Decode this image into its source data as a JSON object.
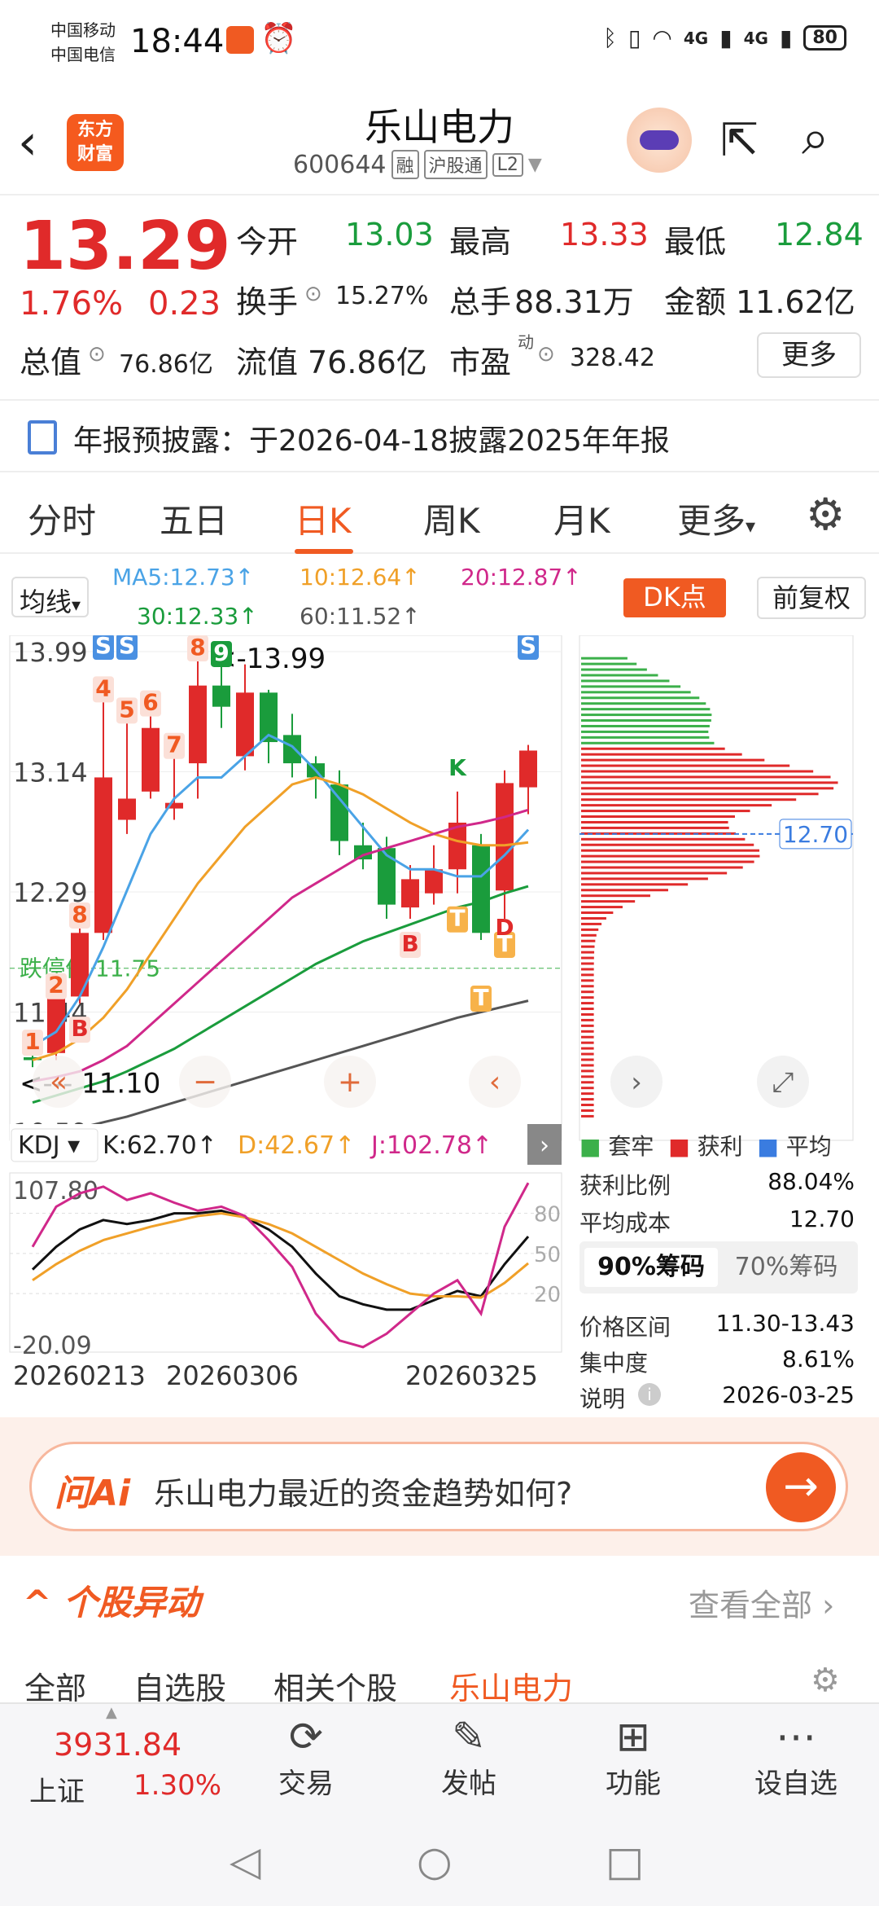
{
  "status_bar": {
    "carrier1": "中国移动",
    "carrier2": "中国电信",
    "time": "18:44",
    "signal1": "4G",
    "signal2": "4G",
    "battery": "80"
  },
  "header": {
    "logo_line1": "东方",
    "logo_line2": "财富",
    "stock_name": "乐山电力",
    "stock_code": "600644",
    "tags": [
      "融",
      "沪股通",
      "L2"
    ]
  },
  "quote": {
    "price": "13.29",
    "change_pct": "1.76%",
    "change": "0.23",
    "open_label": "今开",
    "open": "13.03",
    "high_label": "最高",
    "high": "13.33",
    "low_label": "最低",
    "low": "12.84",
    "turnover_label": "换手",
    "turnover": "15.27%",
    "volume_label": "总手",
    "volume": "88.31万",
    "amount_label": "金额",
    "amount": "11.62亿",
    "mcap_label": "总值",
    "mcap": "76.86亿",
    "float_label": "流值",
    "float_mcap": "76.86亿",
    "pe_label": "市盈",
    "pe_sup": "动",
    "pe": "328.42",
    "more": "更多"
  },
  "notice": {
    "text": "年报预披露：于2026-04-18披露2025年年报"
  },
  "tabs": [
    {
      "label": "分时"
    },
    {
      "label": "五日"
    },
    {
      "label": "日K"
    },
    {
      "label": "周K"
    },
    {
      "label": "月K"
    },
    {
      "label": "更多"
    }
  ],
  "ma_legend": {
    "selector": "均线",
    "ma5": "MA5:12.73↑",
    "ma10": "10:12.64↑",
    "ma20": "20:12.87↑",
    "ma30": "30:12.33↑",
    "ma60": "60:11.52↑",
    "dk_button": "DK点",
    "adjust_button": "前复权"
  },
  "colors": {
    "up": "#e02a2a",
    "down": "#1a9c3c",
    "accent": "#f05a22",
    "ma5": "#4aa3e6",
    "ma10": "#f0a028",
    "ma20": "#d0288a",
    "ma30": "#1a9c3c",
    "ma60": "#555555"
  },
  "kline": {
    "y_top": "13.99",
    "y_mid1": "13.14",
    "y_mid2": "12.29",
    "y_mid3": "11.44",
    "y_bottom": "10.59",
    "high_marker": "13.99",
    "low_marker": "11.10",
    "limit_down_label": "跌停价",
    "limit_down": "11.75",
    "candles": [
      {
        "o": 11.12,
        "c": 11.1,
        "h": 11.2,
        "l": 11.05
      },
      {
        "o": 11.15,
        "c": 11.55,
        "h": 11.6,
        "l": 11.1
      },
      {
        "o": 11.55,
        "c": 12.0,
        "h": 12.1,
        "l": 11.5
      },
      {
        "o": 12.0,
        "c": 13.1,
        "h": 13.7,
        "l": 11.95
      },
      {
        "o": 12.8,
        "c": 12.95,
        "h": 13.55,
        "l": 12.7
      },
      {
        "o": 13.0,
        "c": 13.45,
        "h": 13.6,
        "l": 12.95
      },
      {
        "o": 12.88,
        "c": 12.92,
        "h": 13.3,
        "l": 12.8
      },
      {
        "o": 13.2,
        "c": 13.75,
        "h": 13.99,
        "l": 12.95
      },
      {
        "o": 13.75,
        "c": 13.6,
        "h": 13.95,
        "l": 13.45
      },
      {
        "o": 13.25,
        "c": 13.7,
        "h": 13.9,
        "l": 13.15
      },
      {
        "o": 13.7,
        "c": 13.35,
        "h": 13.72,
        "l": 13.2
      },
      {
        "o": 13.4,
        "c": 13.2,
        "h": 13.55,
        "l": 13.1
      },
      {
        "o": 13.2,
        "c": 13.1,
        "h": 13.25,
        "l": 12.95
      },
      {
        "o": 13.05,
        "c": 12.65,
        "h": 13.15,
        "l": 12.55
      },
      {
        "o": 12.62,
        "c": 12.52,
        "h": 12.78,
        "l": 12.45
      },
      {
        "o": 12.6,
        "c": 12.2,
        "h": 12.68,
        "l": 12.1
      },
      {
        "o": 12.18,
        "c": 12.38,
        "h": 12.48,
        "l": 12.1
      },
      {
        "o": 12.28,
        "c": 12.45,
        "h": 12.62,
        "l": 12.2
      },
      {
        "o": 12.45,
        "c": 12.78,
        "h": 13.0,
        "l": 12.28
      },
      {
        "o": 12.62,
        "c": 12.0,
        "h": 12.7,
        "l": 11.95
      },
      {
        "o": 12.3,
        "c": 13.06,
        "h": 13.15,
        "l": 12.1
      },
      {
        "o": 13.03,
        "c": 13.29,
        "h": 13.33,
        "l": 12.84
      }
    ],
    "ma5": [
      11.2,
      11.3,
      11.55,
      11.9,
      12.3,
      12.7,
      12.95,
      13.1,
      13.1,
      13.25,
      13.4,
      13.32,
      13.15,
      12.95,
      12.75,
      12.55,
      12.45,
      12.45,
      12.4,
      12.4,
      12.55,
      12.73
    ],
    "ma10": [
      11.1,
      11.15,
      11.25,
      11.4,
      11.6,
      11.85,
      12.1,
      12.35,
      12.55,
      12.75,
      12.9,
      13.05,
      13.1,
      13.05,
      12.98,
      12.88,
      12.78,
      12.7,
      12.65,
      12.62,
      12.62,
      12.64
    ],
    "ma20": [
      10.95,
      10.98,
      11.02,
      11.1,
      11.2,
      11.35,
      11.5,
      11.65,
      11.8,
      11.95,
      12.1,
      12.25,
      12.35,
      12.45,
      12.55,
      12.6,
      12.65,
      12.7,
      12.75,
      12.78,
      12.82,
      12.87
    ],
    "ma30": [
      10.8,
      10.85,
      10.9,
      10.95,
      11.02,
      11.1,
      11.18,
      11.28,
      11.38,
      11.48,
      11.58,
      11.68,
      11.78,
      11.86,
      11.94,
      12.0,
      12.06,
      12.12,
      12.18,
      12.22,
      12.28,
      12.33
    ],
    "ma60": [
      10.55,
      10.58,
      10.62,
      10.66,
      10.7,
      10.75,
      10.8,
      10.85,
      10.9,
      10.95,
      11.0,
      11.05,
      11.1,
      11.15,
      11.2,
      11.25,
      11.3,
      11.35,
      11.4,
      11.44,
      11.48,
      11.52
    ],
    "signals": [
      {
        "text": "S",
        "idx": 3
      },
      {
        "text": "S",
        "idx": 4
      },
      {
        "text": "S",
        "idx": 21
      },
      {
        "text": "4",
        "idx": 3
      },
      {
        "text": "5",
        "idx": 4
      },
      {
        "text": "6",
        "idx": 5
      },
      {
        "text": "7",
        "idx": 6
      },
      {
        "text": "8",
        "idx": 7
      },
      {
        "text": "9",
        "idx": 8
      },
      {
        "text": "1",
        "idx": 0
      },
      {
        "text": "2",
        "idx": 1
      },
      {
        "text": "8",
        "idx": 2
      },
      {
        "text": "B",
        "idx": 2
      },
      {
        "text": "B",
        "idx": 16
      },
      {
        "text": "T",
        "idx": 18
      },
      {
        "text": "T",
        "idx": 19
      },
      {
        "text": "T",
        "idx": 20
      },
      {
        "text": "K",
        "idx": 18
      },
      {
        "text": "D",
        "idx": 20
      }
    ]
  },
  "chip_dist": {
    "avg_cost_marker": "12.70",
    "legend": [
      "套牢",
      "获利",
      "平均"
    ],
    "profit_ratio_label": "获利比例",
    "profit_ratio": "88.04%",
    "avg_cost_label": "平均成本",
    "avg_cost": "12.70",
    "tab_90": "90%筹码",
    "tab_70": "70%筹码",
    "range_label": "价格区间",
    "range": "11.30-13.43",
    "concentration_label": "集中度",
    "concentration": "8.61%",
    "note_label": "说明",
    "note_date": "2026-03-25"
  },
  "kdj": {
    "selector": "KDJ",
    "k": "K:62.70↑",
    "d": "D:42.67↑",
    "j": "J:102.78↑",
    "y_top": "107.80",
    "y_bottom": "-20.09",
    "levels": [
      "80",
      "50",
      "20"
    ],
    "dates": [
      "20260213",
      "20260306",
      "20260325"
    ],
    "k_series": [
      38,
      55,
      68,
      75,
      72,
      75,
      80,
      80,
      82,
      77,
      68,
      55,
      35,
      18,
      12,
      8,
      8,
      15,
      22,
      18,
      42,
      62.7
    ],
    "d_series": [
      30,
      42,
      52,
      60,
      65,
      70,
      74,
      78,
      80,
      77,
      72,
      65,
      55,
      45,
      35,
      27,
      20,
      18,
      18,
      17,
      28,
      42.67
    ],
    "j_series": [
      55,
      85,
      95,
      100,
      90,
      95,
      88,
      82,
      85,
      78,
      60,
      40,
      5,
      -15,
      -20,
      -10,
      5,
      20,
      30,
      5,
      70,
      102.78
    ]
  },
  "ai": {
    "logo": "问Ai",
    "question": "乐山电力最近的资金趋势如何?"
  },
  "movements": {
    "title": "个股异动",
    "view_all": "查看全部",
    "sub_tabs": [
      "全部",
      "自选股",
      "相关个股",
      "乐山电力"
    ]
  },
  "bottom_nav": {
    "index_value": "3931.84",
    "index_name": "上证",
    "index_pct": "1.30%",
    "items": [
      {
        "label": "交易"
      },
      {
        "label": "发帖"
      },
      {
        "label": "功能"
      },
      {
        "label": "设自选"
      }
    ]
  }
}
